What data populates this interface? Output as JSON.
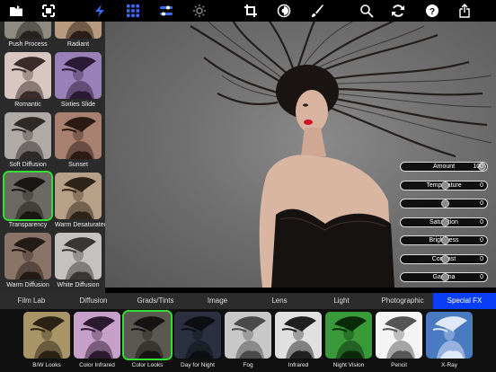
{
  "toolbar": {
    "icons": [
      "folder-icon",
      "fit-screen-icon",
      "lightning-icon",
      "grid-icon",
      "sliders-icon",
      "sun-icon",
      "crop-icon",
      "mask-icon",
      "brush-icon",
      "search-icon",
      "refresh-icon",
      "help-icon",
      "share-icon"
    ],
    "accent": "#3a6bf5"
  },
  "presets": [
    {
      "label": "Push Process",
      "bg": "#8e8a80",
      "fg": "#262220"
    },
    {
      "label": "Radiant",
      "bg": "#b89a80",
      "fg": "#2a1e18"
    },
    {
      "label": "Romantic",
      "bg": "#d8c6c0",
      "fg": "#3a2c2a"
    },
    {
      "label": "Sixties Slide",
      "bg": "#9a80b8",
      "fg": "#2a1a36"
    },
    {
      "label": "Soft Diffusion",
      "bg": "#b0aaa6",
      "fg": "#2e2a28"
    },
    {
      "label": "Sunset",
      "bg": "#a88070",
      "fg": "#2c1a14"
    },
    {
      "label": "Transparency",
      "bg": "#6a6a62",
      "fg": "#1a1614"
    },
    {
      "label": "Warm Desaturated",
      "bg": "#b8a088",
      "fg": "#2e2418"
    },
    {
      "label": "Warm Diffusion",
      "bg": "#8a7468",
      "fg": "#241a16"
    },
    {
      "label": "White Diffusion",
      "bg": "#c4c2c0",
      "fg": "#3a3634"
    }
  ],
  "selected_preset": "Transparency",
  "sliders": [
    {
      "label": "Amount",
      "value": "100",
      "level": 1.0
    },
    {
      "label": "Temperature",
      "value": "0",
      "level": 0.5
    },
    {
      "label": "",
      "value": "0",
      "level": 0.5
    },
    {
      "label": "Saturation",
      "value": "0",
      "level": 0.5
    },
    {
      "label": "Brightness",
      "value": "0",
      "level": 0.5
    },
    {
      "label": "Contrast",
      "value": "0",
      "level": 0.5
    },
    {
      "label": "Gamma",
      "value": "0",
      "level": 0.5
    }
  ],
  "categories": [
    "Film Lab",
    "Diffusion",
    "Grads/Tints",
    "Image",
    "Lens",
    "Light",
    "Photographic",
    "Special FX"
  ],
  "active_category": "Special FX",
  "effects": [
    {
      "label": "B/W Looks",
      "bg": "#a89466",
      "fg": "#2a2214"
    },
    {
      "label": "Color Infrared",
      "bg": "#c6a0c8",
      "fg": "#2e1a30"
    },
    {
      "label": "Color Looks",
      "bg": "#5a5850",
      "fg": "#161412"
    },
    {
      "label": "Day for Night",
      "bg": "#2a3040",
      "fg": "#0c0e14"
    },
    {
      "label": "Fog",
      "bg": "#c8c8c8",
      "fg": "#4a4a4a"
    },
    {
      "label": "Infrared",
      "bg": "#e0e0e0",
      "fg": "#202020"
    },
    {
      "label": "Night Vision",
      "bg": "#3a9a3a",
      "fg": "#0a2a0a"
    },
    {
      "label": "Pencil",
      "bg": "#f4f4f4",
      "fg": "#555555"
    },
    {
      "label": "X-Ray",
      "bg": "#4a7ac0",
      "fg": "#dfe8f8"
    }
  ],
  "selected_effect": "Color Looks",
  "colors": {
    "selection": "#35e035",
    "active_tab": "#0a3df7"
  }
}
